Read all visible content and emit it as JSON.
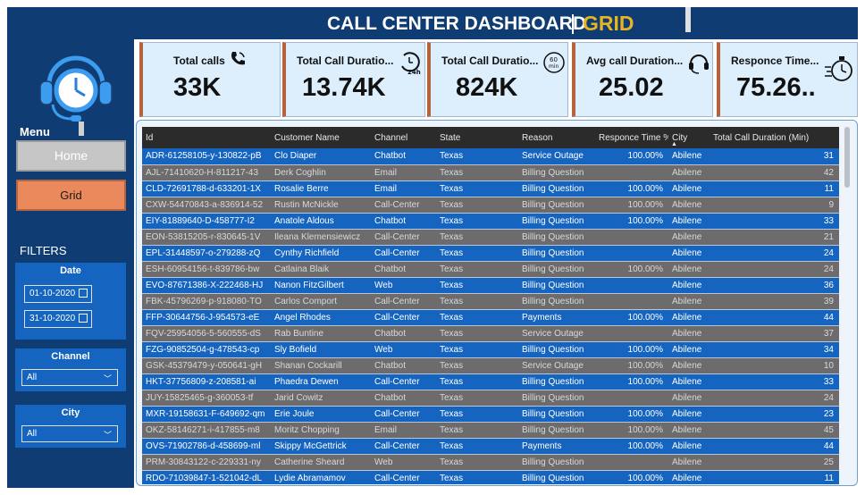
{
  "header": {
    "title": "CALL CENTER DASHBOARD",
    "subtitle": "GRID"
  },
  "sidebar": {
    "menu_label": "Menu",
    "home_label": "Home",
    "grid_label": "Grid",
    "filters_label": "FILTERS",
    "date": {
      "label": "Date",
      "start": "01-10-2020",
      "end": "31-10-2020"
    },
    "channel": {
      "label": "Channel",
      "value": "All"
    },
    "city": {
      "label": "City",
      "value": "All"
    }
  },
  "kpis": [
    {
      "title": "Total calls",
      "value": "33K",
      "icon": "phone-icon"
    },
    {
      "title": "Total Call Duratio...",
      "value": "13.74K",
      "icon": "clock-24h-icon"
    },
    {
      "title": "Total Call Duratio...",
      "value": "824K",
      "icon": "clock-60min-icon"
    },
    {
      "title": "Avg call Duration...",
      "value": "25.02",
      "icon": "headset-icon"
    },
    {
      "title": "Responce Time...",
      "value": "75.26..",
      "icon": "stopwatch-icon"
    }
  ],
  "table": {
    "columns": [
      "Id",
      "Customer Name",
      "Channel",
      "State",
      "Reason",
      "Responce Time %",
      "City",
      "Total Call Duration (Min)"
    ],
    "rows": [
      [
        "ADR-61258105-y-130822-pB",
        "Clo Diaper",
        "Chatbot",
        "Texas",
        "Service Outage",
        "100.00%",
        "Abilene",
        "31"
      ],
      [
        "AJL-71410620-H-811217-43",
        "Derk Coghlin",
        "Email",
        "Texas",
        "Billing Question",
        "",
        "Abilene",
        "42"
      ],
      [
        "CLD-72691788-d-633201-1X",
        "Rosalie Berre",
        "Email",
        "Texas",
        "Billing Question",
        "100.00%",
        "Abilene",
        "11"
      ],
      [
        "CXW-54470843-a-836914-52",
        "Rustin McNickle",
        "Call-Center",
        "Texas",
        "Billing Question",
        "100.00%",
        "Abilene",
        "9"
      ],
      [
        "EIY-81889640-D-458777-I2",
        "Anatole Aldous",
        "Chatbot",
        "Texas",
        "Billing Question",
        "100.00%",
        "Abilene",
        "33"
      ],
      [
        "EON-53815205-r-830645-1V",
        "Ileana Klemensiewicz",
        "Call-Center",
        "Texas",
        "Billing Question",
        "",
        "Abilene",
        "21"
      ],
      [
        "EPL-31448597-o-279288-zQ",
        "Cynthy Richfield",
        "Call-Center",
        "Texas",
        "Billing Question",
        "",
        "Abilene",
        "24"
      ],
      [
        "ESH-60954156-t-839786-bw",
        "Catlaina Blaik",
        "Chatbot",
        "Texas",
        "Billing Question",
        "100.00%",
        "Abilene",
        "24"
      ],
      [
        "EVO-87671386-X-222468-HJ",
        "Nanon FitzGilbert",
        "Web",
        "Texas",
        "Billing Question",
        "",
        "Abilene",
        "36"
      ],
      [
        "FBK-45796269-p-918080-TO",
        "Carlos Comport",
        "Call-Center",
        "Texas",
        "Billing Question",
        "",
        "Abilene",
        "39"
      ],
      [
        "FFP-30644756-J-954573-eE",
        "Angel Rhodes",
        "Call-Center",
        "Texas",
        "Payments",
        "100.00%",
        "Abilene",
        "44"
      ],
      [
        "FQV-25954056-5-560555-dS",
        "Rab Buntine",
        "Chatbot",
        "Texas",
        "Service Outage",
        "",
        "Abilene",
        "37"
      ],
      [
        "FZG-90852504-g-478543-cp",
        "Sly Bofield",
        "Web",
        "Texas",
        "Billing Question",
        "100.00%",
        "Abilene",
        "34"
      ],
      [
        "GSK-45379479-y-050641-gH",
        "Shanan Cockarill",
        "Chatbot",
        "Texas",
        "Service Outage",
        "100.00%",
        "Abilene",
        "10"
      ],
      [
        "HKT-37756809-z-208581-ai",
        "Phaedra Dewen",
        "Call-Center",
        "Texas",
        "Billing Question",
        "100.00%",
        "Abilene",
        "33"
      ],
      [
        "JUY-15825465-g-360053-tf",
        "Jarid Cowitz",
        "Chatbot",
        "Texas",
        "Billing Question",
        "",
        "Abilene",
        "24"
      ],
      [
        "MXR-19158631-F-649692-qm",
        "Erie Joule",
        "Call-Center",
        "Texas",
        "Billing Question",
        "100.00%",
        "Abilene",
        "23"
      ],
      [
        "OKZ-58146271-i-417855-m8",
        "Moritz Chopping",
        "Email",
        "Texas",
        "Billing Question",
        "100.00%",
        "Abilene",
        "45"
      ],
      [
        "OVS-71902786-d-458699-ml",
        "Skippy McGettrick",
        "Call-Center",
        "Texas",
        "Payments",
        "100.00%",
        "Abilene",
        "44"
      ],
      [
        "PRM-30843122-c-229331-ny",
        "Catherine Sheard",
        "Web",
        "Texas",
        "Billing Question",
        "",
        "Abilene",
        "25"
      ],
      [
        "RDO-71039847-1-521042-dL",
        "Lydie Abramamov",
        "Call-Center",
        "Texas",
        "Billing Question",
        "100.00%",
        "Abilene",
        "11"
      ]
    ]
  },
  "colors": {
    "primary": "#0f3d73",
    "accent": "#e6b521",
    "row_blue": "#1565c0",
    "row_gray": "#6d6b6b",
    "kpi_bg": "#ddeefc",
    "kpi_border": "#b5633a"
  }
}
